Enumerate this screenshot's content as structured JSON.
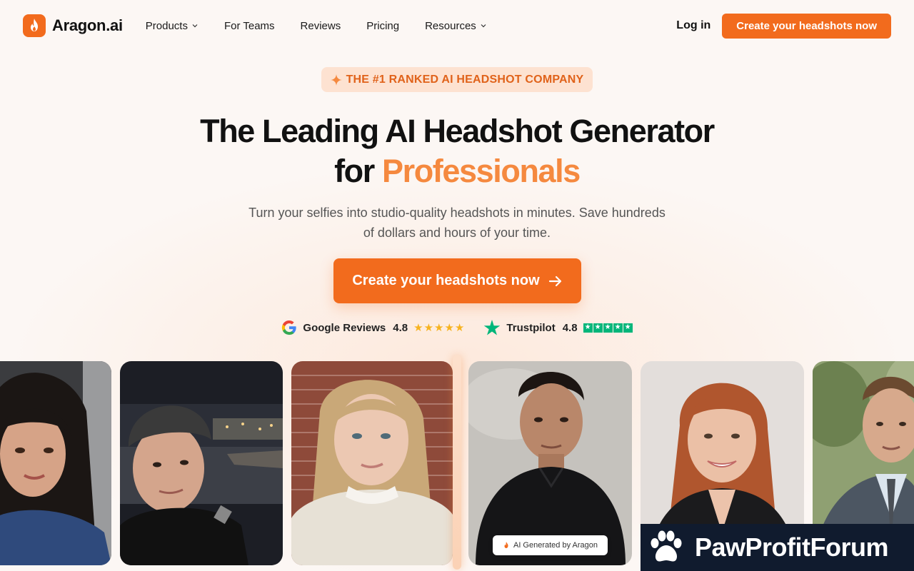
{
  "nav": {
    "brand": "Aragon.ai",
    "links": [
      {
        "label": "Products",
        "has_dropdown": true
      },
      {
        "label": "For Teams",
        "has_dropdown": false
      },
      {
        "label": "Reviews",
        "has_dropdown": false
      },
      {
        "label": "Pricing",
        "has_dropdown": false
      },
      {
        "label": "Resources",
        "has_dropdown": true
      }
    ],
    "login": "Log in",
    "cta": "Create your headshots now"
  },
  "hero": {
    "badge": "THE #1 RANKED AI HEADSHOT COMPANY",
    "headline_line1": "The Leading AI Headshot Generator",
    "headline_for": "for",
    "headline_accent": "Professionals",
    "subtext": "Turn your selfies into studio-quality headshots in minutes. Save hundreds of dollars and hours of your time.",
    "cta": "Create your headshots now"
  },
  "ratings": [
    {
      "source": "Google Reviews",
      "score": "4.8",
      "stars": 5,
      "icon": "google-icon"
    },
    {
      "source": "Trustpilot",
      "score": "4.8",
      "stars": 5,
      "icon": "trustpilot-icon"
    }
  ],
  "gallery": {
    "ai_badge": "AI Generated by Aragon",
    "photos": [
      {
        "name": "selfie-woman-dark-hair",
        "kind": "selfie"
      },
      {
        "name": "selfie-man-beanie",
        "kind": "selfie"
      },
      {
        "name": "selfie-woman-sweater",
        "kind": "selfie"
      },
      {
        "name": "headshot-man-black-shirt",
        "kind": "ai-generated"
      },
      {
        "name": "headshot-woman-red-hair",
        "kind": "ai-generated"
      },
      {
        "name": "headshot-man-suit",
        "kind": "ai-generated"
      }
    ]
  },
  "watermark": {
    "text": "PawProfitForum"
  },
  "colors": {
    "accent": "#f26b1d",
    "accent_light": "#f5893f",
    "badge_bg": "#fde2d1",
    "background": "#fcf7f4",
    "google_star": "#f7b320",
    "trustpilot_green": "#00b67a",
    "watermark_bg": "#101b2e"
  }
}
